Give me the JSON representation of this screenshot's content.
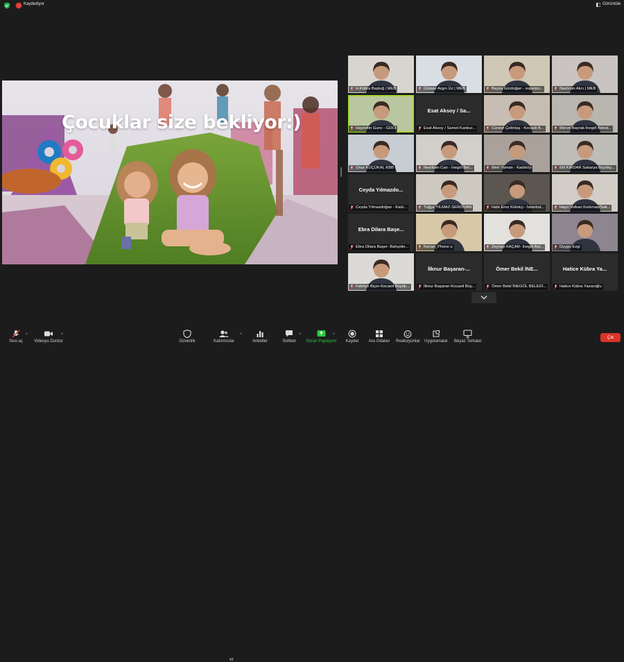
{
  "topbar": {
    "recording_label": "Kaydediyor",
    "view_label": "Görüntüle"
  },
  "share": {
    "caption": "Çocuklar size bekliyor:)"
  },
  "participants": [
    {
      "label": "H.Kübra Baştuğ | MEB",
      "video": true,
      "bg": "#d8d5d0"
    },
    {
      "label": "Görsev Argın Üz | MEB",
      "video": true,
      "bg": "#d9dee4"
    },
    {
      "label": "Beyza Gürdoğan - superpo...",
      "video": true,
      "bg": "#cfc7b5"
    },
    {
      "label": "Nazlıcan Akcı | MEB",
      "video": true,
      "bg": "#c9c3c1"
    },
    {
      "label": "Hayrettin Gunc - GDCI",
      "video": true,
      "bg": "#b9c7a0",
      "active": true
    },
    {
      "label": "Esat Aksoy / Samet Kanbur...",
      "video": false,
      "name": "Esat Aksoy / Sa..."
    },
    {
      "label": "Cüneyt Çetintaş - Kocaeli B...",
      "video": true,
      "bg": "#c8bdb2"
    },
    {
      "label": "Merve Bayrak-İnegöl Beled...",
      "video": true,
      "bg": "#b9b6b0"
    },
    {
      "label": "Onur KÜÇÜKAL KBB",
      "video": true,
      "bg": "#c7cdd2"
    },
    {
      "label": "Neslihan Can - İnegöl Bel...",
      "video": true,
      "bg": "#d2cfca"
    },
    {
      "label": "Mert Yaman - Kadıköy",
      "video": true,
      "bg": "#a9a19a"
    },
    {
      "label": "Elif KIRDAR Sakarya Büyükş...",
      "video": true,
      "bg": "#bdbcb7"
    },
    {
      "label": "Ceyda Yılmazdoğan - Kadı...",
      "video": false,
      "name": "Ceyda Yılmazdo..."
    },
    {
      "label": "Tuğçe YILMAZ-SERDİVAN",
      "video": true,
      "bg": "#cdc9c1"
    },
    {
      "label": "Hale Erez Külekçi - İstanbul...",
      "video": true,
      "bg": "#5c5650"
    },
    {
      "label": "Hayri Volkan Korkmaz/Sak...",
      "video": true,
      "bg": "#d2cdc6"
    },
    {
      "label": "Ebra Dilara Başer- Bahçelie...",
      "video": false,
      "name": "Ebra Dilara Başe..."
    },
    {
      "label": "Kenan_Phone u",
      "video": true,
      "bg": "#d7c9a8"
    },
    {
      "label": "Zeynep KAÇAR- İnegöl Bel...",
      "video": true,
      "bg": "#e3e1dd"
    },
    {
      "label": "Duygu Ezgi",
      "video": true,
      "bg": "#8d8590"
    },
    {
      "label": "Fahriye Biçer-Kocaeli Büyük...",
      "video": true,
      "bg": "#dcdad6"
    },
    {
      "label": "İlknur Başaran-Kocaeli Büy...",
      "video": false,
      "name": "İlknur Başaran-..."
    },
    {
      "label": "Ömer Bekil İNEGÖL BELEDİ...",
      "video": false,
      "name": "Ömer Bekil İNE..."
    },
    {
      "label": "Hatice Kübra Yazaroğlu",
      "video": false,
      "name": "Hatice Kübra Ya..."
    }
  ],
  "toolbar": {
    "mute_label": "Sesi aç",
    "video_label": "Videoyu Durdur",
    "security_label": "Güvenlik",
    "participants_label": "Katılımcılar",
    "participants_count": "43",
    "polls_label": "Anketler",
    "chat_label": "Sohbet",
    "share_label": "Ekran Paylaşımı",
    "record_label": "Kaydet",
    "rooms_label": "Ara Odaları",
    "reactions_label": "Reaksiyonlar",
    "apps_label": "Uygulamalar",
    "whiteboard_label": "Beyaz Tahtalar",
    "end_label": "Çık"
  },
  "colors": {
    "background": "#1c1c1c",
    "active_speaker": "#a8d832",
    "share_green": "#28c840",
    "end_red": "#d9342b",
    "record_red": "#e0443a"
  },
  "icons": [
    "shield-icon",
    "record-dot-icon",
    "view-icon",
    "mic-muted-icon",
    "video-camera-icon",
    "security-icon",
    "participants-icon",
    "polls-icon",
    "chat-icon",
    "share-screen-icon",
    "record-icon",
    "breakout-rooms-icon",
    "reactions-icon",
    "apps-icon",
    "whiteboard-icon",
    "chevron-down-icon"
  ]
}
